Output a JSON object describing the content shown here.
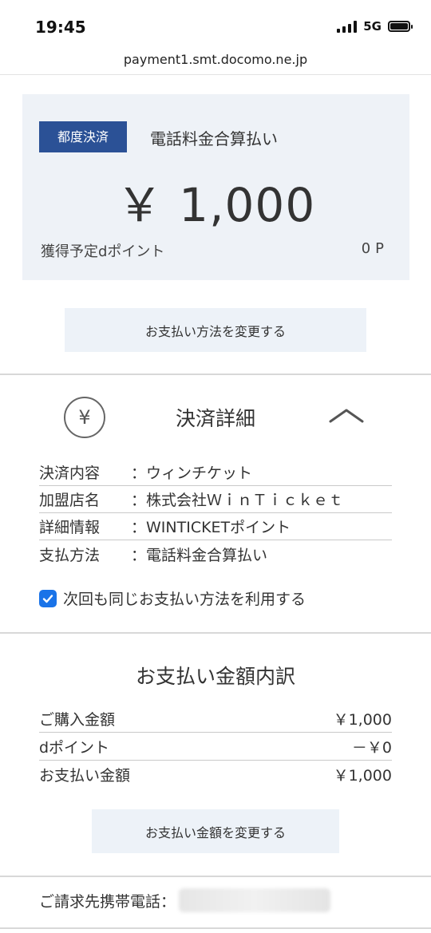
{
  "status_bar": {
    "time": "19:45",
    "network": "5G"
  },
  "browser": {
    "url": "payment1.smt.docomo.ne.jp"
  },
  "summary": {
    "badge": "都度決済",
    "method": "電話料金合算払い",
    "amount": "￥ 1,000",
    "points_label": "獲得予定dポイント",
    "points_value": "0P"
  },
  "actions": {
    "change_method": "お支払い方法を変更する",
    "change_amount": "お支払い金額を変更する"
  },
  "details": {
    "icon": "yen-circle-icon",
    "title": "決済詳細",
    "rows": [
      {
        "label": "決済内容",
        "value": "：ウィンチケット"
      },
      {
        "label": "加盟店名",
        "value": "：株式会社ＷｉｎＴｉｃｋｅｔ"
      },
      {
        "label": "詳細情報",
        "value": "：WINTICKETポイント"
      },
      {
        "label": "支払方法",
        "value": "：電話料金合算払い"
      }
    ],
    "checkbox_label": "次回も同じお支払い方法を利用する"
  },
  "breakdown": {
    "title": "お支払い金額内訳",
    "rows": [
      {
        "label": "ご購入金額",
        "value": "￥1,000"
      },
      {
        "label": "dポイント",
        "value": "－￥0"
      },
      {
        "label": "お支払い金額",
        "value": "￥1,000"
      }
    ]
  },
  "billing": {
    "label": "ご請求先携帯電話："
  },
  "colors": {
    "accent_badge": "#2b5196",
    "card_bg": "#eef2f7",
    "checkbox": "#1a73e8"
  }
}
